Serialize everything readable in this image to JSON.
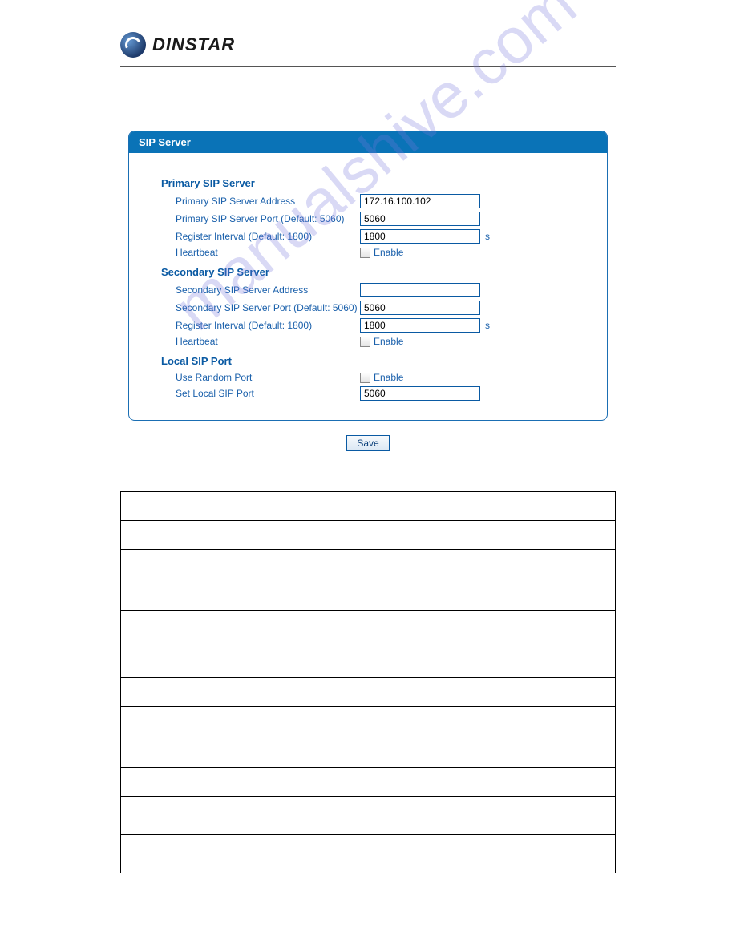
{
  "brand": "DINSTAR",
  "watermark": "manualshive.com",
  "panel": {
    "title": "SIP Server",
    "primary": {
      "heading": "Primary SIP Server",
      "addr_label": "Primary SIP Server Address",
      "addr_value": "172.16.100.102",
      "port_label": "Primary SIP Server Port (Default: 5060)",
      "port_value": "5060",
      "interval_label": "Register Interval (Default: 1800)",
      "interval_value": "1800",
      "interval_suffix": "s",
      "heartbeat_label": "Heartbeat",
      "heartbeat_enable": "Enable"
    },
    "secondary": {
      "heading": "Secondary SIP Server",
      "addr_label": "Secondary SIP Server Address",
      "addr_value": "",
      "port_label": "Secondary SIP Server Port (Default: 5060)",
      "port_value": "5060",
      "interval_label": "Register Interval (Default: 1800)",
      "interval_value": "1800",
      "interval_suffix": "s",
      "heartbeat_label": "Heartbeat",
      "heartbeat_enable": "Enable"
    },
    "local": {
      "heading": "Local SIP Port",
      "random_label": "Use Random Port",
      "random_enable": "Enable",
      "set_port_label": "Set Local SIP Port",
      "set_port_value": "5060"
    },
    "save_label": "Save"
  }
}
